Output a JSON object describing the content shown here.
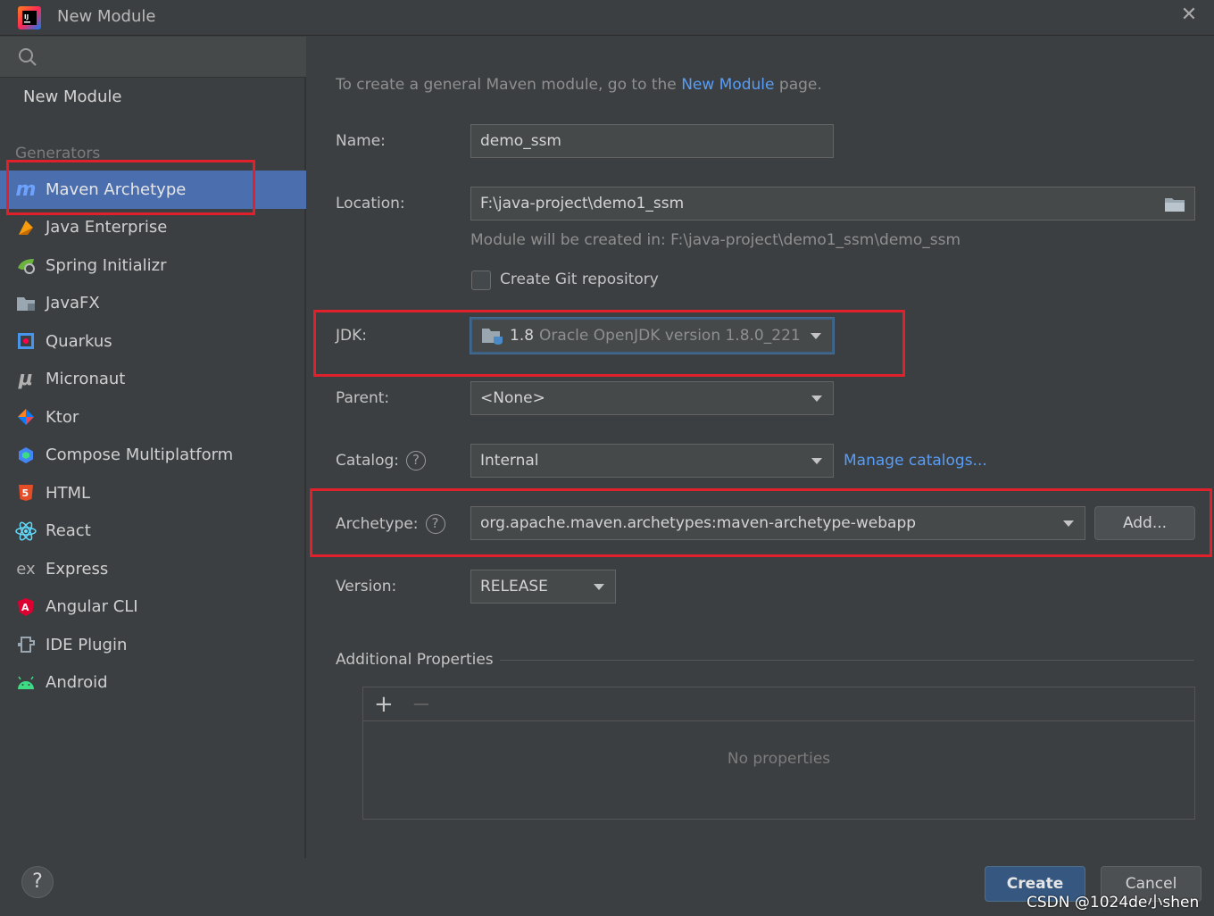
{
  "window": {
    "title": "New Module"
  },
  "sidebar": {
    "search_placeholder": "",
    "top_item": "New Module",
    "group_label": "Generators",
    "items": [
      {
        "label": "Maven Archetype",
        "icon": "maven-icon",
        "selected": true
      },
      {
        "label": "Java Enterprise",
        "icon": "java-enterprise-icon"
      },
      {
        "label": "Spring Initializr",
        "icon": "spring-icon"
      },
      {
        "label": "JavaFX",
        "icon": "javafx-folder-icon"
      },
      {
        "label": "Quarkus",
        "icon": "quarkus-icon"
      },
      {
        "label": "Micronaut",
        "icon": "micronaut-icon"
      },
      {
        "label": "Ktor",
        "icon": "ktor-icon"
      },
      {
        "label": "Compose Multiplatform",
        "icon": "compose-icon"
      },
      {
        "label": "HTML",
        "icon": "html5-icon"
      },
      {
        "label": "React",
        "icon": "react-icon"
      },
      {
        "label": "Express",
        "icon": "express-icon"
      },
      {
        "label": "Angular CLI",
        "icon": "angular-icon"
      },
      {
        "label": "IDE Plugin",
        "icon": "ide-plugin-icon"
      },
      {
        "label": "Android",
        "icon": "android-icon"
      }
    ],
    "help": "?"
  },
  "form": {
    "info_prefix": "To create a general Maven module, go to the",
    "info_link": "New Module",
    "info_suffix": "page.",
    "name_label": "Name:",
    "name_value": "demo_ssm",
    "location_label": "Location:",
    "location_value": "F:\\java-project\\demo1_ssm",
    "location_hint": "Module will be created in: F:\\java-project\\demo1_ssm\\demo_ssm",
    "git_label": "Create Git repository",
    "jdk_label": "JDK:",
    "jdk_version": "1.8",
    "jdk_name": "Oracle OpenJDK version 1.8.0_221",
    "parent_label": "Parent:",
    "parent_value": "<None>",
    "catalog_label": "Catalog:",
    "catalog_value": "Internal",
    "manage_catalogs": "Manage catalogs...",
    "archetype_label": "Archetype:",
    "archetype_value": "org.apache.maven.archetypes:maven-archetype-webapp",
    "add_button": "Add...",
    "version_label": "Version:",
    "version_value": "RELEASE",
    "additional_properties": "Additional Properties",
    "add_prop": "+",
    "remove_prop": "−",
    "no_properties": "No properties"
  },
  "buttons": {
    "create": "Create",
    "cancel": "Cancel"
  },
  "watermark": "CSDN @1024de小shen",
  "colors": {
    "accent": "#4b6eaf",
    "link": "#589df6",
    "annotation": "#e0212b"
  }
}
